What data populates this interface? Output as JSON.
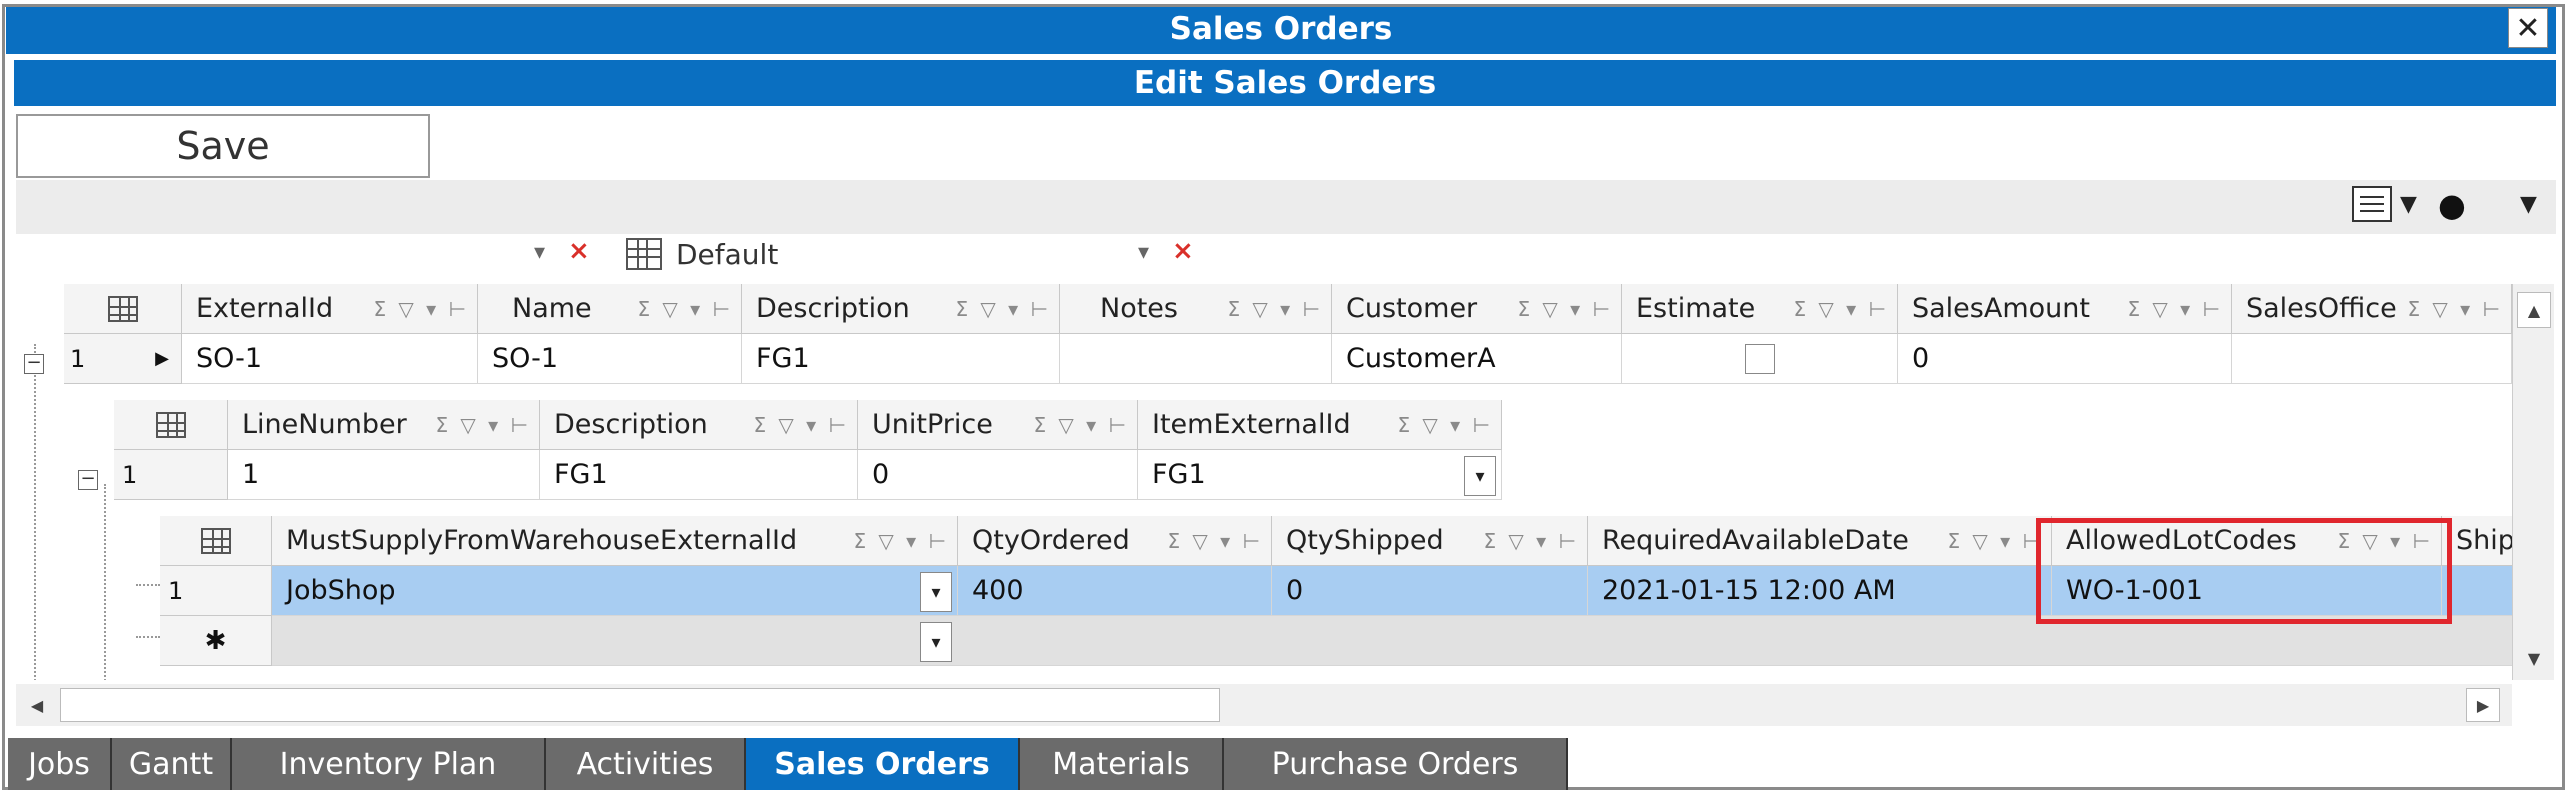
{
  "window": {
    "title": "Sales Orders",
    "close_glyph": "✕"
  },
  "panel": {
    "title": "Edit Sales Orders"
  },
  "toolbar": {
    "save_label": "Save"
  },
  "layout_selector": {
    "value": "Default"
  },
  "grid": {
    "so_columns": [
      "ExternalId",
      "Name",
      "Description",
      "Notes",
      "Customer",
      "Estimate",
      "SalesAmount",
      "SalesOffice"
    ],
    "so_row": {
      "num": "1",
      "externalId": "SO-1",
      "name": "SO-1",
      "description": "FG1",
      "notes": "",
      "customer": "CustomerA",
      "estimate": false,
      "salesAmount": "0",
      "salesOffice": ""
    },
    "line_columns": [
      "LineNumber",
      "Description",
      "UnitPrice",
      "ItemExternalId"
    ],
    "line_row": {
      "num": "1",
      "lineNumber": "1",
      "description": "FG1",
      "unitPrice": "0",
      "itemExternalId": "FG1"
    },
    "dist_columns": [
      "MustSupplyFromWarehouseExternalId",
      "QtyOrdered",
      "QtyShipped",
      "RequiredAvailableDate",
      "AllowedLotCodes",
      "ShipT"
    ],
    "dist_row": {
      "num": "1",
      "warehouse": "JobShop",
      "qtyOrdered": "400",
      "qtyShipped": "0",
      "requiredDate": "2021-01-15 12:00 AM",
      "allowedLotCodes": "WO-1-001"
    },
    "new_row_glyph": "✱",
    "header_tools": "Σ ▽ ▾ ⊢"
  },
  "tabs": [
    {
      "label": "Jobs"
    },
    {
      "label": "Gantt"
    },
    {
      "label": "Inventory Plan"
    },
    {
      "label": "Activities"
    },
    {
      "label": "Sales Orders",
      "active": true
    },
    {
      "label": "Materials"
    },
    {
      "label": "Purchase Orders"
    }
  ],
  "colors": {
    "accent": "#0a6fc1",
    "highlight": "#e0262d",
    "selection": "#a8cdf2"
  }
}
